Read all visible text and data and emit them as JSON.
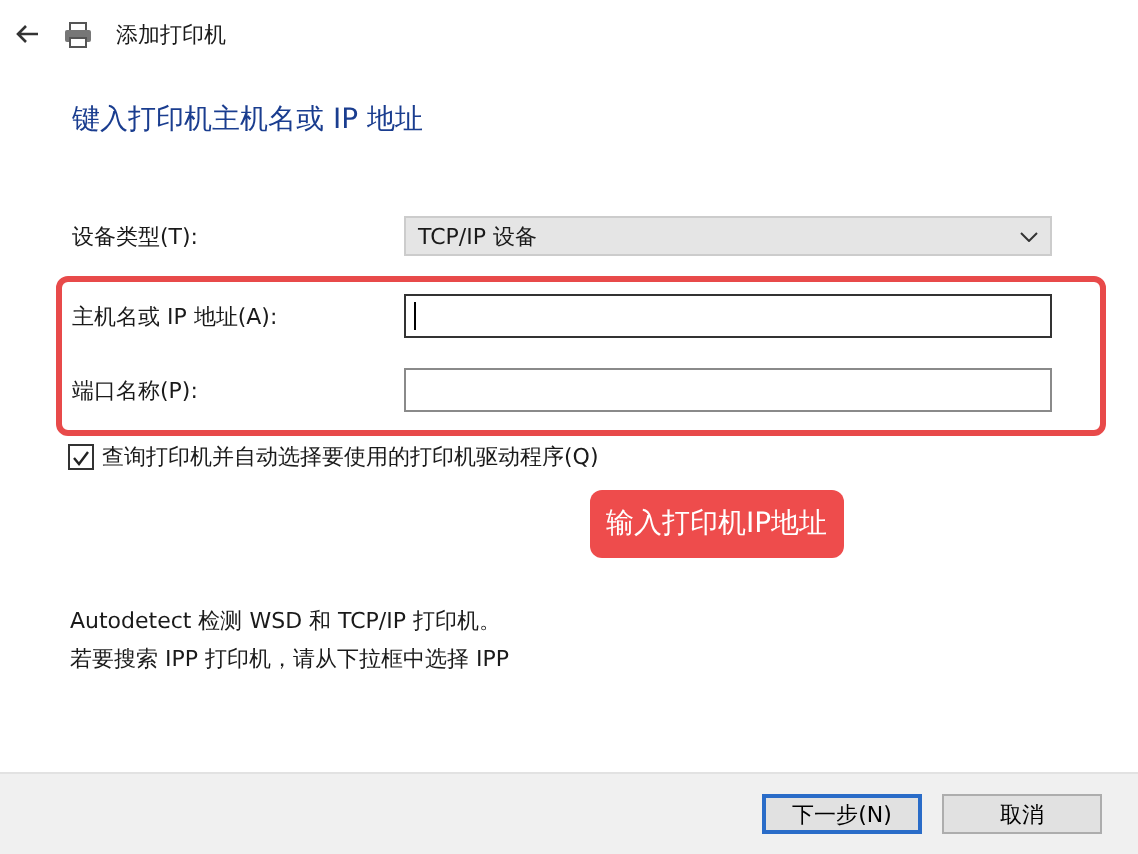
{
  "window": {
    "title": "添加打印机"
  },
  "heading": "键入打印机主机名或 IP 地址",
  "device_type": {
    "label": "设备类型(T):",
    "value": "TCP/IP 设备"
  },
  "fields": [
    {
      "label": "主机名或 IP 地址(A):",
      "focused": true
    },
    {
      "label": "端口名称(P):",
      "focused": false
    }
  ],
  "query_checkbox": {
    "label": "查询打印机并自动选择要使用的打印机驱动程序(Q)",
    "checked": true
  },
  "callout": "输入打印机IP地址",
  "notes": [
    "Autodetect 检测 WSD 和 TCP/IP 打印机。",
    "若要搜索 IPP 打印机，请从下拉框中选择 IPP"
  ],
  "buttons": [
    {
      "label": "下一步(N)",
      "default": true
    },
    {
      "label": "取消",
      "default": false
    }
  ]
}
